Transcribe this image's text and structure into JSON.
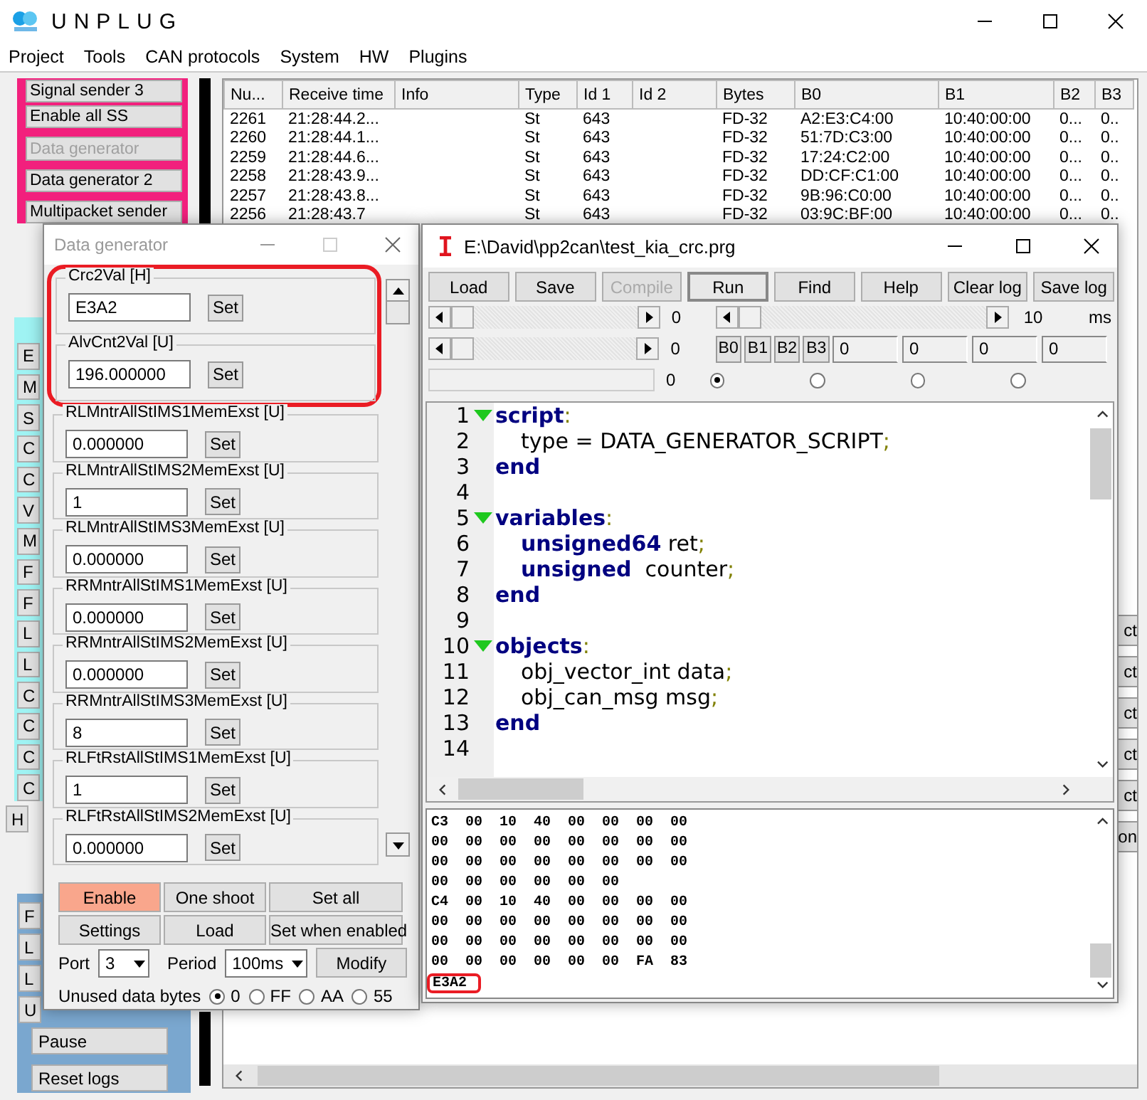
{
  "window": {
    "title": "UNPLUG"
  },
  "menu": [
    "Project",
    "Tools",
    "CAN protocols",
    "System",
    "HW",
    "Plugins"
  ],
  "left_panel": {
    "top_buttons": [
      {
        "label": "Signal sender 3",
        "disabled": false
      },
      {
        "label": "Enable all SS",
        "disabled": false
      },
      {
        "label": "Data generator",
        "disabled": true
      },
      {
        "label": "Data generator 2",
        "disabled": false
      },
      {
        "label": "Multipacket sender",
        "disabled": false
      }
    ],
    "side_stubs": [
      "E",
      "M",
      "S",
      "C",
      "C",
      "V",
      "M",
      "F",
      "F",
      "L",
      "L",
      "C",
      "C",
      "C",
      "C"
    ],
    "lower_stubs": [
      "H"
    ],
    "blue_stubs": [
      "F",
      "L",
      "L",
      "U"
    ],
    "bottom_buttons": [
      "Pause",
      "Reset logs"
    ]
  },
  "table": {
    "columns": [
      "Nu...",
      "Receive time",
      "Info",
      "Type",
      "Id 1",
      "Id 2",
      "Bytes",
      "B0",
      "B1",
      "B2",
      "B3"
    ],
    "rows": [
      [
        "2261",
        "21:28:44.2...",
        "",
        "St",
        "643",
        "",
        "FD-32",
        "A2:E3:C4:00",
        "10:40:00:00",
        "0...",
        "0.."
      ],
      [
        "2260",
        "21:28:44.1...",
        "",
        "St",
        "643",
        "",
        "FD-32",
        "51:7D:C3:00",
        "10:40:00:00",
        "0...",
        "0.."
      ],
      [
        "2259",
        "21:28:44.6...",
        "",
        "St",
        "643",
        "",
        "FD-32",
        "17:24:C2:00",
        "10:40:00:00",
        "0...",
        "0.."
      ],
      [
        "2258",
        "21:28:43.9...",
        "",
        "St",
        "643",
        "",
        "FD-32",
        "DD:CF:C1:00",
        "10:40:00:00",
        "0...",
        "0.."
      ],
      [
        "2257",
        "21:28:43.8...",
        "",
        "St",
        "643",
        "",
        "FD-32",
        "9B:96:C0:00",
        "10:40:00:00",
        "0...",
        "0.."
      ],
      [
        "2256",
        "21:28:43.7",
        "",
        "St",
        "643",
        "",
        "FD-32",
        "03:9C:BF:00",
        "10:40:00:00",
        "0...",
        "0.."
      ]
    ]
  },
  "right_fragments": [
    "ct",
    "ct",
    "ct",
    "ct",
    "ct",
    "on"
  ],
  "data_generator": {
    "title": "Data generator",
    "fields": [
      {
        "label": "Crc2Val [H]",
        "value": "E3A2",
        "button": "Set",
        "highlighted": true
      },
      {
        "label": "AlvCnt2Val [U]",
        "value": "196.000000",
        "button": "Set",
        "highlighted": true
      },
      {
        "label": "RLMntrAllStIMS1MemExst [U]",
        "value": "0.000000",
        "button": "Set",
        "highlighted": false
      },
      {
        "label": "RLMntrAllStIMS2MemExst [U]",
        "value": "1",
        "button": "Set",
        "highlighted": false
      },
      {
        "label": "RLMntrAllStIMS3MemExst [U]",
        "value": "0.000000",
        "button": "Set",
        "highlighted": false
      },
      {
        "label": "RRMntrAllStIMS1MemExst [U]",
        "value": "0.000000",
        "button": "Set",
        "highlighted": false
      },
      {
        "label": "RRMntrAllStIMS2MemExst [U]",
        "value": "0.000000",
        "button": "Set",
        "highlighted": false
      },
      {
        "label": "RRMntrAllStIMS3MemExst [U]",
        "value": "8",
        "button": "Set",
        "highlighted": false
      },
      {
        "label": "RLFtRstAllStIMS1MemExst [U]",
        "value": "1",
        "button": "Set",
        "highlighted": false
      },
      {
        "label": "RLFtRstAllStIMS2MemExst [U]",
        "value": "0.000000",
        "button": "Set",
        "highlighted": false
      }
    ],
    "buttons": [
      {
        "label": "Enable",
        "active": true
      },
      {
        "label": "One shoot",
        "active": false
      },
      {
        "label": "Set all",
        "active": false
      },
      {
        "label": "Settings",
        "active": false
      },
      {
        "label": "Load",
        "active": false
      },
      {
        "label": "Set when enabled",
        "active": false
      }
    ],
    "port": {
      "label": "Port",
      "value": "3"
    },
    "period": {
      "label": "Period",
      "value": "100ms"
    },
    "modify": "Modify",
    "unused": {
      "label": "Unused data bytes",
      "options": [
        {
          "label": "0",
          "selected": true
        },
        {
          "label": "FF",
          "selected": false
        },
        {
          "label": "AA",
          "selected": false
        },
        {
          "label": "55",
          "selected": false
        }
      ]
    }
  },
  "script_window": {
    "title": "E:\\David\\pp2can\\test_kia_crc.prg",
    "toolbar": [
      {
        "label": "Load",
        "disabled": false,
        "pressed": false
      },
      {
        "label": "Save",
        "disabled": false,
        "pressed": false
      },
      {
        "label": "Compile",
        "disabled": true,
        "pressed": false
      },
      {
        "label": "Run",
        "disabled": false,
        "pressed": true
      },
      {
        "label": "Find",
        "disabled": false,
        "pressed": false
      },
      {
        "label": "Help",
        "disabled": false,
        "pressed": false
      },
      {
        "label": "Clear log",
        "disabled": false,
        "pressed": false
      },
      {
        "label": "Save log",
        "disabled": false,
        "pressed": false
      }
    ],
    "scroll_readouts": [
      "0",
      "0"
    ],
    "field_readout": "0",
    "period_scroll": {
      "reading": "10",
      "unit": "ms"
    },
    "byte_buttons": [
      "B0",
      "B1",
      "B2",
      "B3"
    ],
    "byte_fields": [
      "0",
      "0",
      "0",
      "0"
    ],
    "radios": [
      {
        "selected": true
      },
      {
        "selected": false
      },
      {
        "selected": false
      },
      {
        "selected": false
      }
    ],
    "code": [
      {
        "number": "1",
        "fold": true,
        "indent": false,
        "parts": [
          {
            "kind": "keyword",
            "text": "script"
          },
          {
            "kind": "punct",
            "text": ":"
          }
        ]
      },
      {
        "number": "2",
        "fold": false,
        "indent": true,
        "parts": [
          {
            "kind": "text",
            "text": "type = DATA_GENERATOR_SCRIPT"
          },
          {
            "kind": "punct",
            "text": ";"
          }
        ]
      },
      {
        "number": "3",
        "fold": false,
        "indent": false,
        "parts": [
          {
            "kind": "keyword",
            "text": "end"
          }
        ]
      },
      {
        "number": "4",
        "fold": false
      },
      {
        "number": "5",
        "fold": true,
        "indent": false,
        "parts": [
          {
            "kind": "keyword",
            "text": "variables"
          },
          {
            "kind": "punct",
            "text": ":"
          }
        ]
      },
      {
        "number": "6",
        "fold": false,
        "indent": true,
        "parts": [
          {
            "kind": "keyword",
            "text": "unsigned64"
          },
          {
            "kind": "text",
            "text": " ret"
          },
          {
            "kind": "punct",
            "text": ";"
          }
        ]
      },
      {
        "number": "7",
        "fold": false,
        "indent": true,
        "parts": [
          {
            "kind": "keyword",
            "text": "unsigned"
          },
          {
            "kind": "text",
            "text": "  counter"
          },
          {
            "kind": "punct",
            "text": ";"
          }
        ]
      },
      {
        "number": "8",
        "fold": false,
        "indent": false,
        "parts": [
          {
            "kind": "keyword",
            "text": "end"
          }
        ]
      },
      {
        "number": "9",
        "fold": false
      },
      {
        "number": "10",
        "fold": true,
        "indent": false,
        "parts": [
          {
            "kind": "keyword",
            "text": "objects"
          },
          {
            "kind": "punct",
            "text": ":"
          }
        ]
      },
      {
        "number": "11",
        "fold": false,
        "indent": true,
        "parts": [
          {
            "kind": "text",
            "text": "obj_vector_int data"
          },
          {
            "kind": "punct",
            "text": ";"
          }
        ]
      },
      {
        "number": "12",
        "fold": false,
        "indent": true,
        "parts": [
          {
            "kind": "text",
            "text": "obj_can_msg msg"
          },
          {
            "kind": "punct",
            "text": ";"
          }
        ]
      },
      {
        "number": "13",
        "fold": false,
        "indent": false,
        "parts": [
          {
            "kind": "keyword",
            "text": "end"
          }
        ]
      },
      {
        "number": "14",
        "fold": false
      }
    ],
    "log": [
      {
        "text": "C3  00  10  40  00  00  00  00",
        "highlighted": false
      },
      {
        "text": "00  00  00  00  00  00  00  00",
        "highlighted": false
      },
      {
        "text": "00  00  00  00  00  00  00  00",
        "highlighted": false
      },
      {
        "text": "00  00  00  00  00  00",
        "highlighted": false
      },
      {
        "text": "C4  00  10  40  00  00  00  00",
        "highlighted": false
      },
      {
        "text": "00  00  00  00  00  00  00  00",
        "highlighted": false
      },
      {
        "text": "00  00  00  00  00  00  00  00",
        "highlighted": false
      },
      {
        "text": "00  00  00  00  00  00  FA  83",
        "highlighted": false
      },
      {
        "text": "E3A2",
        "highlighted": true
      }
    ]
  }
}
